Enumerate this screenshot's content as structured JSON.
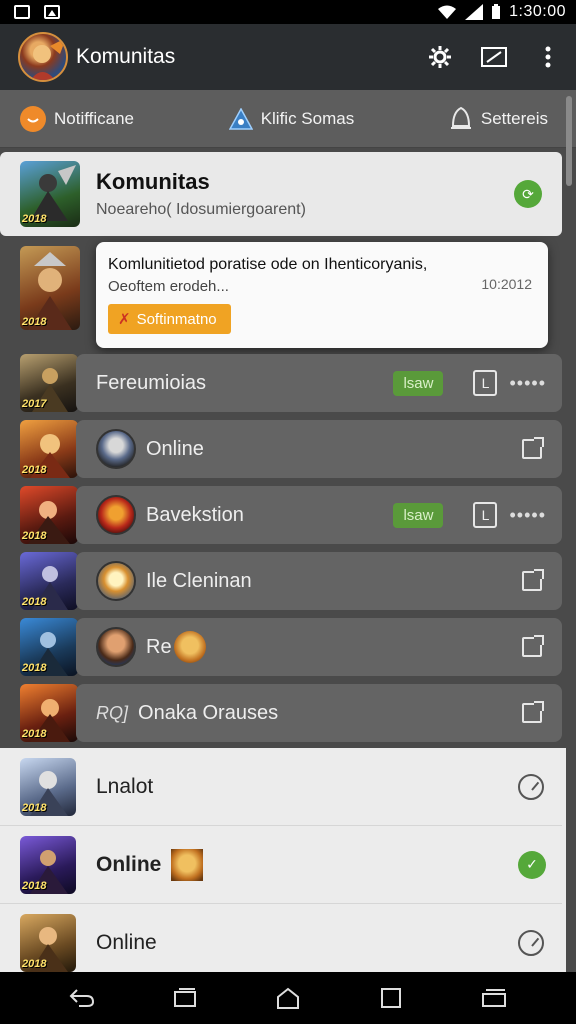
{
  "status_bar": {
    "time": "1:30:00"
  },
  "app_bar": {
    "title": "Komunitas"
  },
  "tabs": [
    {
      "label": "Notifficane"
    },
    {
      "label": "Klific Somas"
    },
    {
      "label": "Settereis"
    }
  ],
  "header_card": {
    "title": "Komunitas",
    "subtitle": "Noeareho( Idosumiergoarent)"
  },
  "popup": {
    "message": "Komlunitietod poratise ode on Ihenticoryanis,",
    "sub": "Oeoftem erodeh...",
    "time": "10:2012",
    "button_label": "Softinmatno"
  },
  "rows": [
    {
      "label": "Fereumioias",
      "pill": "lsaw",
      "year": "2017"
    },
    {
      "label": "Online",
      "year": "2018"
    },
    {
      "label": "Bavekstion",
      "pill": "lsaw",
      "year": "2018"
    },
    {
      "label": "Ile Cleninan",
      "year": "2018"
    },
    {
      "label": "Re",
      "year": "2018"
    },
    {
      "label": "Onaka Orauses",
      "prefix": "RQ]",
      "year": "2018"
    }
  ],
  "light_rows": [
    {
      "label": "Lnalot",
      "year": "2018"
    },
    {
      "label": "Online",
      "year": "2018"
    },
    {
      "label": "Online",
      "year": "2018"
    }
  ],
  "header_thumb_year": "2018",
  "popup_thumb_year": "2018",
  "colors": {
    "accent_orange": "#f0a323",
    "green": "#5a9a3a",
    "appbar": "#2a2d30"
  }
}
